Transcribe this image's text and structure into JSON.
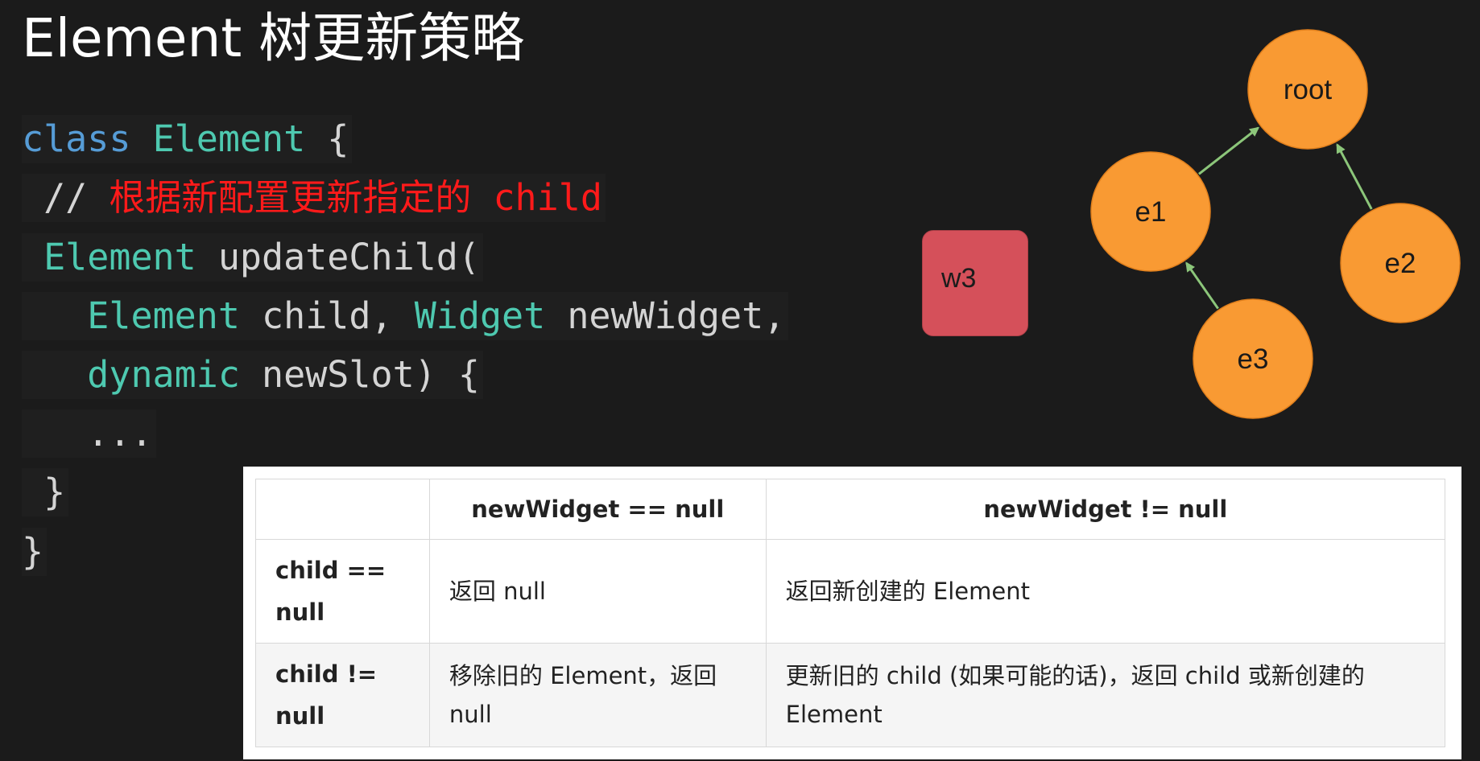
{
  "title": "Element 树更新策略",
  "code": {
    "line1": {
      "kw": "class",
      "type": "Element",
      "rest": " {"
    },
    "line2": {
      "prefix": " // ",
      "comment": "根据新配置更新指定的 child"
    },
    "line3": {
      "type": "Element",
      "rest": " updateChild("
    },
    "line4": {
      "type1": "Element",
      "text1": " child, ",
      "type2": "Widget",
      "text2": " newWidget,"
    },
    "line5": {
      "type": "dynamic",
      "rest": " newSlot) {"
    },
    "line6": "...",
    "line7": "}",
    "line8": "}"
  },
  "widget_box": {
    "label": "w3"
  },
  "graph": {
    "nodes": [
      {
        "id": "root",
        "label": "root"
      },
      {
        "id": "e1",
        "label": "e1"
      },
      {
        "id": "e2",
        "label": "e2"
      },
      {
        "id": "e3",
        "label": "e3"
      }
    ],
    "edges": [
      {
        "from": "e1",
        "to": "root"
      },
      {
        "from": "e2",
        "to": "root"
      },
      {
        "from": "e3",
        "to": "e1"
      }
    ]
  },
  "table": {
    "headers": [
      "",
      "newWidget == null",
      "newWidget != null"
    ],
    "rows": [
      {
        "head": "child == null",
        "cells": [
          "返回 null",
          "返回新创建的 Element"
        ]
      },
      {
        "head": "child != null",
        "cells": [
          "移除旧的 Element，返回 null",
          "更新旧的 child (如果可能的话)，返回 child 或新创建的 Element"
        ]
      }
    ]
  },
  "colors": {
    "background": "#1b1b1b",
    "keyword": "#569cd6",
    "type": "#4ec9b0",
    "comment_highlight": "#ff1a1a",
    "node_fill": "#f99a33",
    "edge": "#8cc67a",
    "widget_box": "#d5505a"
  }
}
